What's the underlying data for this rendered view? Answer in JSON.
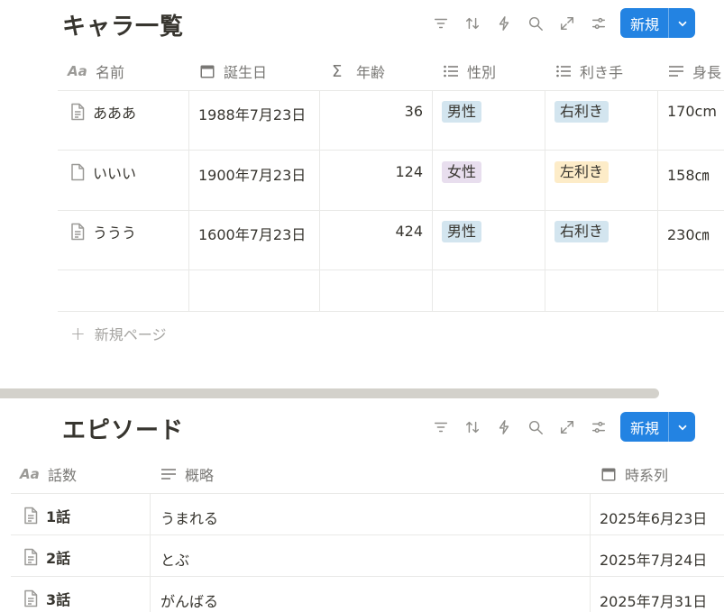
{
  "colors": {
    "accent": "#2383e2",
    "tag_blue_bg": "#d3e5ef",
    "tag_purple_bg": "#e8deee",
    "tag_yellow_bg": "#fdecc8"
  },
  "characters": {
    "title": "キャラ一覧",
    "new_label": "新規",
    "toolbar_icons": [
      "filter-icon",
      "sort-icon",
      "automation-icon",
      "search-icon",
      "expand-icon",
      "settings-icon"
    ],
    "columns": {
      "name": {
        "label": "名前",
        "icon": "Aa"
      },
      "birthday": {
        "label": "誕生日",
        "icon": "calendar-icon"
      },
      "age": {
        "label": "年齢",
        "icon": "Σ"
      },
      "gender": {
        "label": "性別",
        "icon": "list-icon"
      },
      "hand": {
        "label": "利き手",
        "icon": "list-icon"
      },
      "height": {
        "label": "身長",
        "icon": "text-icon"
      }
    },
    "rows": [
      {
        "name": "あああ",
        "birthday": "1988年7月23日",
        "age": "36",
        "gender": "男性",
        "gender_color": "#d3e5ef",
        "hand": "右利き",
        "hand_color": "#d3e5ef",
        "height": "170cm"
      },
      {
        "name": "いいい",
        "birthday": "1900年7月23日",
        "age": "124",
        "gender": "女性",
        "gender_color": "#e8deee",
        "hand": "左利き",
        "hand_color": "#fdecc8",
        "height": "158㎝"
      },
      {
        "name": "ううう",
        "birthday": "1600年7月23日",
        "age": "424",
        "gender": "男性",
        "gender_color": "#d3e5ef",
        "hand": "右利き",
        "hand_color": "#d3e5ef",
        "height": "230㎝"
      }
    ],
    "new_page_label": "新規ページ"
  },
  "episodes": {
    "title": "エピソード",
    "new_label": "新規",
    "columns": {
      "number": {
        "label": "話数",
        "icon": "Aa"
      },
      "summary": {
        "label": "概略",
        "icon": "text-icon"
      },
      "date": {
        "label": "時系列",
        "icon": "calendar-icon"
      }
    },
    "rows": [
      {
        "number": "1話",
        "summary": "うまれる",
        "date": "2025年6月23日"
      },
      {
        "number": "2話",
        "summary": "とぶ",
        "date": "2025年7月24日"
      },
      {
        "number": "3話",
        "summary": "がんばる",
        "date": "2025年7月31日"
      }
    ]
  }
}
